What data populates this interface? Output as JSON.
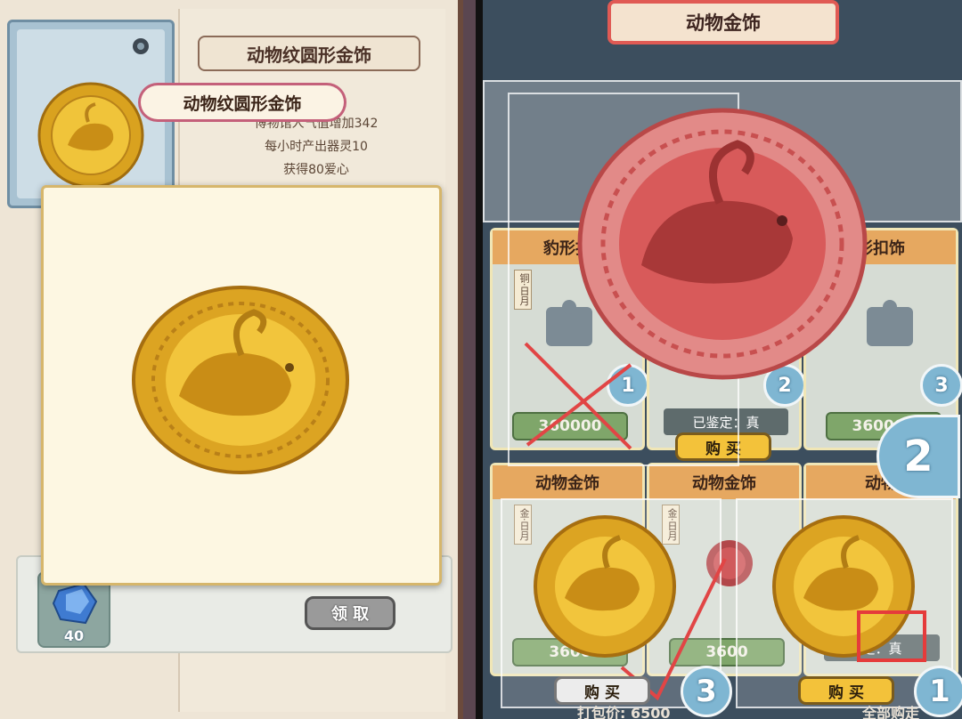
{
  "left": {
    "title_plate": "动物纹圆形金饰",
    "name_tag": "动物纹圆形金饰",
    "desc_lines": [
      "博物馆人气值增加342",
      "每小时产出器灵10",
      "获得80爱心"
    ],
    "reward_count": "40",
    "claim_label": "领 取"
  },
  "right": {
    "banner": "动物金饰",
    "cards": {
      "c1_title": "豹形扣",
      "c1_tag": "铜·日月",
      "c1_corner": "1",
      "c1_price": "360000",
      "c2_status": "已鉴定：真",
      "c2_buy": "购 买",
      "c2_corner": "2",
      "c3_title": "形扣饰",
      "c3_corner": "3",
      "c3_price": "360000",
      "c4_title": "动物金饰",
      "c4_tag": "金·日月",
      "c4_price": "3600",
      "c5_title": "动物金饰",
      "c5_tag": "金·日月",
      "c5_price": "3600",
      "c6_title": "动物",
      "c6_status": "定：真",
      "bottom_buy_left": "购 买",
      "bottom_buy_right": "购 买",
      "corner_3": "3",
      "corner_1": "1",
      "corner_2_big": "2"
    },
    "footer_left": "打包价: 6500",
    "footer_right": "全部购走"
  },
  "colors": {
    "gold": "#e2b52a",
    "red_coin": "#d24a4a",
    "highlight": "#e53b3b",
    "buy_btn": "#f3c23a"
  }
}
